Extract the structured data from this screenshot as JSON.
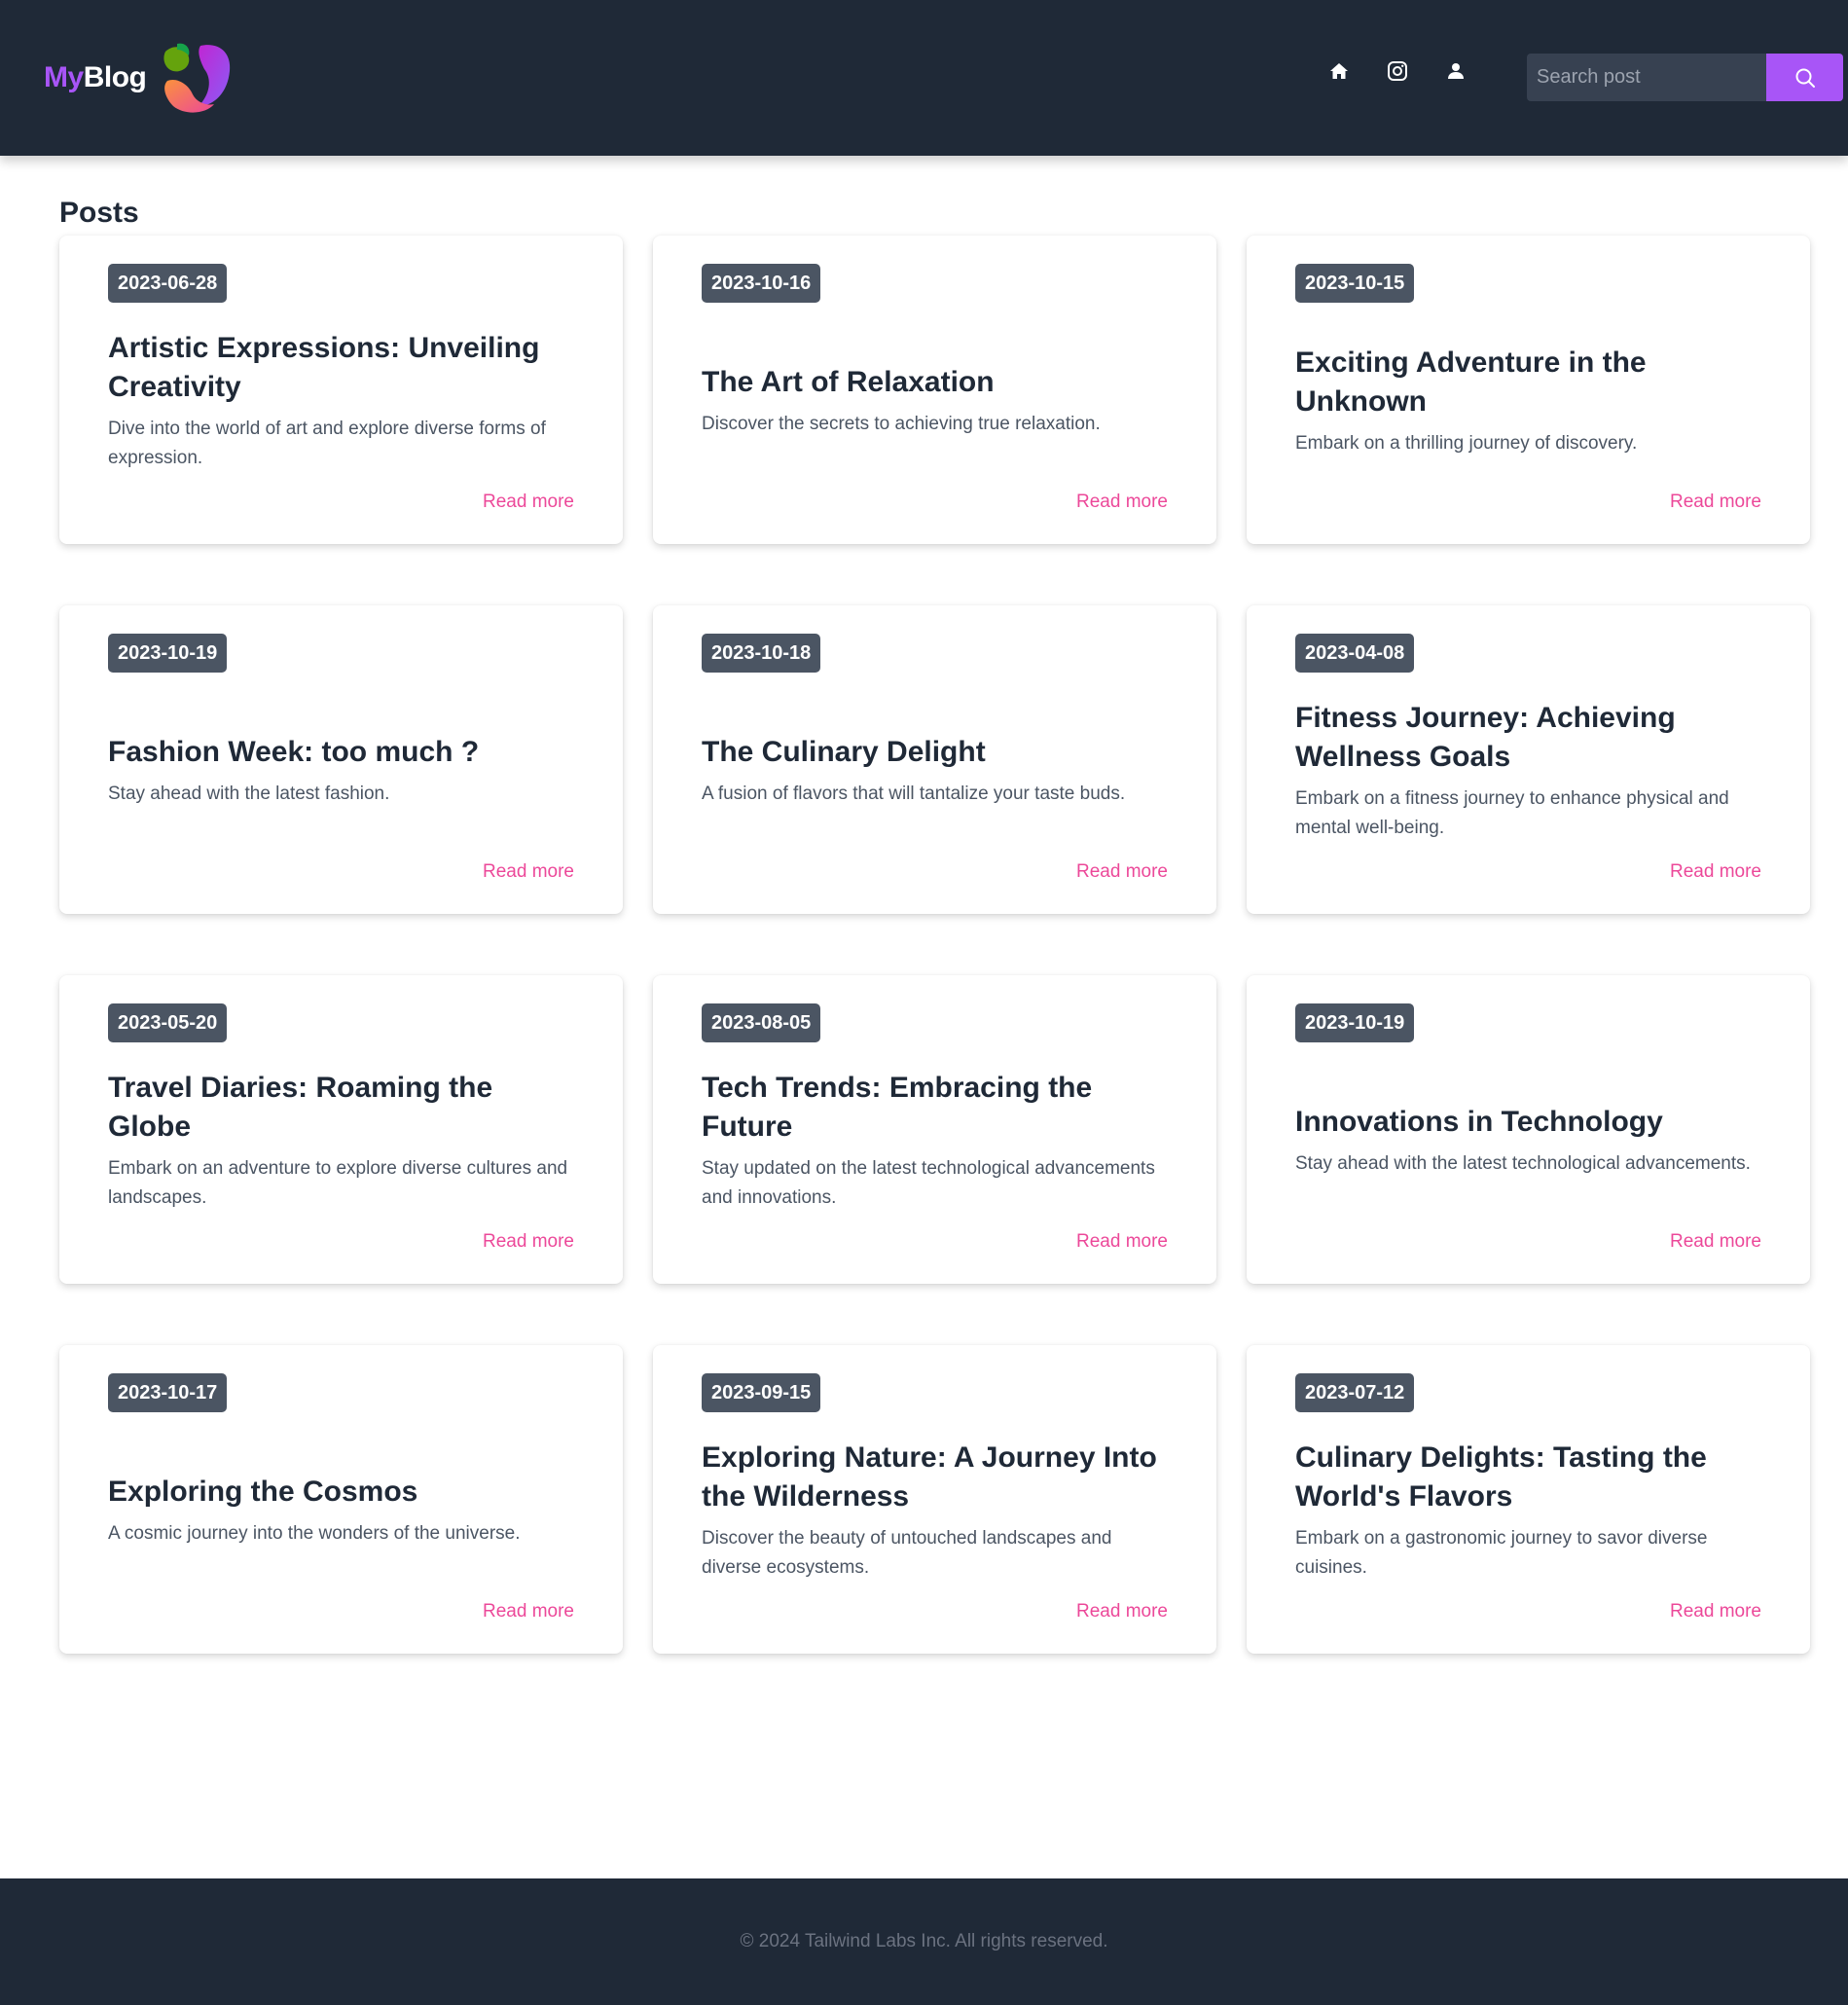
{
  "brand": {
    "my": "My",
    "blog": "Blog"
  },
  "nav": {
    "icons": [
      "home-icon",
      "instagram-icon",
      "user-icon"
    ]
  },
  "search": {
    "placeholder": "Search post",
    "icon": "search-icon"
  },
  "colors": {
    "header_bg": "#1f2937",
    "accent": "#a855f7",
    "link": "#ec4899",
    "badge": "#4b5563"
  },
  "posts": {
    "heading": "Posts",
    "items": [
      {
        "date": "2023-06-28",
        "title": "Artistic Expressions: Unveiling Creativity",
        "description": "Dive into the world of art and explore diverse forms of expression.",
        "link": "Read more"
      },
      {
        "date": "2023-10-16",
        "title": "The Art of Relaxation",
        "description": "Discover the secrets to achieving true relaxation.",
        "link": "Read more"
      },
      {
        "date": "2023-10-15",
        "title": "Exciting Adventure in the Unknown",
        "description": "Embark on a thrilling journey of discovery.",
        "link": "Read more"
      },
      {
        "date": "2023-10-19",
        "title": "Fashion Week: too much ?",
        "description": "Stay ahead with the latest fashion.",
        "link": "Read more"
      },
      {
        "date": "2023-10-18",
        "title": "The Culinary Delight",
        "description": "A fusion of flavors that will tantalize your taste buds.",
        "link": "Read more"
      },
      {
        "date": "2023-04-08",
        "title": "Fitness Journey: Achieving Wellness Goals",
        "description": "Embark on a fitness journey to enhance physical and mental well-being.",
        "link": "Read more"
      },
      {
        "date": "2023-05-20",
        "title": "Travel Diaries: Roaming the Globe",
        "description": "Embark on an adventure to explore diverse cultures and landscapes.",
        "link": "Read more"
      },
      {
        "date": "2023-08-05",
        "title": "Tech Trends: Embracing the Future",
        "description": "Stay updated on the latest technological advancements and innovations.",
        "link": "Read more"
      },
      {
        "date": "2023-10-19",
        "title": "Innovations in Technology",
        "description": "Stay ahead with the latest technological advancements.",
        "link": "Read more"
      },
      {
        "date": "2023-10-17",
        "title": "Exploring the Cosmos",
        "description": "A cosmic journey into the wonders of the universe.",
        "link": "Read more"
      },
      {
        "date": "2023-09-15",
        "title": "Exploring Nature: A Journey Into the Wilderness",
        "description": "Discover the beauty of untouched landscapes and diverse ecosystems.",
        "link": "Read more"
      },
      {
        "date": "2023-07-12",
        "title": "Culinary Delights: Tasting the World's Flavors",
        "description": "Embark on a gastronomic journey to savor diverse cuisines.",
        "link": "Read more"
      }
    ]
  },
  "footer": {
    "text": "© 2024 Tailwind Labs Inc. All rights reserved."
  }
}
